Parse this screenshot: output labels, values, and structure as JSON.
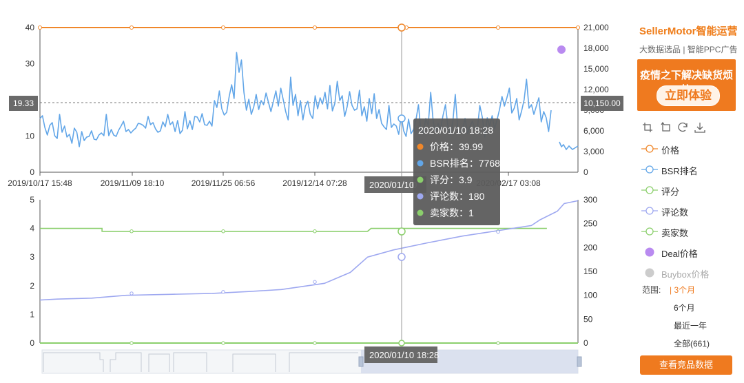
{
  "chart_data": [
    {
      "type": "line",
      "panel": "price-bsr",
      "x_ticks": [
        "2019/10/17 15:48",
        "2019/11/09 18:10",
        "2019/11/25 06:56",
        "2019/12/14 07:28",
        "2020/02/17 03:08"
      ],
      "y_left_ticks": [
        "0",
        "10",
        "20",
        "30",
        "40"
      ],
      "y_right_ticks": [
        "0",
        "3,000",
        "6,000",
        "9,000",
        "12,000",
        "15,000",
        "18,000",
        "21,000"
      ],
      "ylim_left": [
        0,
        40
      ],
      "ylim_right": [
        0,
        21000
      ],
      "reference_line": {
        "left_label": "19.33",
        "right_label": "10,150.00"
      },
      "series": [
        {
          "name": "价格",
          "color": "#f0872a",
          "axis": "left",
          "values": [
            40,
            40,
            40,
            40,
            40,
            40,
            40,
            40,
            40,
            40,
            40,
            40,
            40,
            40,
            40,
            40,
            40,
            40,
            40,
            40,
            40,
            40,
            40,
            40,
            40,
            40,
            40,
            40,
            40,
            40,
            40,
            40,
            40,
            40,
            40,
            40,
            40,
            40,
            40,
            40,
            40,
            40,
            40,
            40,
            40,
            40,
            40,
            40,
            40,
            40,
            40,
            40,
            40,
            40,
            40,
            40,
            40,
            40,
            40,
            40,
            40,
            40,
            40,
            40,
            40,
            40,
            40,
            40,
            40,
            40,
            40,
            40,
            40,
            40,
            40,
            40,
            40,
            40,
            40,
            40,
            40,
            40,
            40,
            40,
            40,
            40,
            40,
            40,
            40,
            40,
            40,
            40,
            40,
            40,
            40,
            40,
            40,
            40,
            40,
            40,
            40,
            40,
            40,
            40,
            40,
            40,
            40,
            40,
            40,
            40,
            40,
            40,
            40,
            40,
            40,
            40,
            40,
            40,
            40,
            40,
            40,
            40,
            40,
            40,
            40,
            40,
            40,
            40,
            40,
            40,
            40,
            40,
            40,
            40,
            40,
            40,
            40,
            40,
            40,
            40,
            40,
            40,
            40,
            40,
            40,
            40,
            40,
            40,
            40,
            40,
            40,
            40,
            40,
            40,
            40,
            40,
            40,
            40,
            40,
            40,
            40,
            40,
            40,
            40,
            40,
            40,
            40,
            40,
            40,
            40,
            40,
            40,
            40,
            40,
            40,
            40,
            40,
            40,
            40,
            40,
            40,
            40,
            40,
            40,
            40,
            40,
            40,
            40,
            40,
            40,
            40,
            40,
            40,
            40,
            40,
            40,
            40,
            40,
            40,
            40,
            40
          ]
        },
        {
          "name": "BSR排名",
          "color": "#62a6e8",
          "axis": "right",
          "values": [
            7800,
            8200,
            6500,
            5400,
            6800,
            7200,
            5300,
            4900,
            8400,
            5800,
            6700,
            5100,
            5500,
            4200,
            6400,
            5800,
            3700,
            5900,
            4600,
            5100,
            5200,
            6000,
            4800,
            4700,
            5400,
            5700,
            5300,
            8400,
            5300,
            6200,
            5400,
            5200,
            6100,
            6700,
            7400,
            5900,
            6200,
            5700,
            6100,
            6400,
            7100,
            7000,
            6800,
            6400,
            8100,
            6900,
            7200,
            6300,
            5800,
            6000,
            7300,
            6600,
            8400,
            6900,
            7300,
            5900,
            7500,
            5600,
            6100,
            8800,
            6300,
            7500,
            6200,
            8100,
            8000,
            7300,
            8500,
            6900,
            6800,
            7400,
            6700,
            10400,
            9400,
            11800,
            9200,
            8300,
            8700,
            11000,
            12700,
            10700,
            17400,
            14500,
            16300,
            11600,
            9000,
            10600,
            8400,
            9500,
            11300,
            9100,
            10400,
            9800,
            11500,
            10100,
            8800,
            10300,
            11800,
            9600,
            12200,
            10500,
            8800,
            7600,
            13800,
            9700,
            11300,
            8200,
            10400,
            7600,
            9600,
            10300,
            8400,
            7800,
            11100,
            9200,
            10800,
            9900,
            11600,
            9200,
            12600,
            8900,
            10000,
            13200,
            10400,
            11100,
            8100,
            9500,
            11700,
            9700,
            9000,
            9200,
            11900,
            8200,
            9500,
            7400,
            10700,
            8500,
            11400,
            7800,
            9100,
            7100,
            6600,
            6200,
            9700,
            6500,
            7000,
            6700,
            5500,
            8200,
            6000,
            5200,
            7700,
            5600,
            6200,
            7600,
            9800,
            6100,
            5700,
            7800,
            6800,
            11600,
            7400,
            5700,
            7100,
            6200,
            8200,
            9800,
            6600,
            5500,
            7300,
            11300,
            6400,
            5800,
            6300,
            7800,
            5600,
            6700,
            7400,
            6300,
            6300,
            9700,
            8000,
            5100,
            7900,
            6700,
            8200,
            6300,
            7600,
            9100,
            11000,
            9600,
            10800,
            12200,
            8600,
            9300,
            10700,
            7600,
            8900,
            10500,
            13500,
            9300,
            9800,
            8400,
            9600,
            10800,
            7300,
            8800,
            7900,
            5900,
            9000
          ]
        }
      ]
    },
    {
      "type": "line",
      "panel": "rating-reviews",
      "y_left_ticks": [
        "0",
        "1",
        "2",
        "3",
        "4",
        "5"
      ],
      "y_right_ticks": [
        "0",
        "50",
        "100",
        "150",
        "200",
        "250",
        "300"
      ],
      "ylim_left": [
        0,
        5
      ],
      "ylim_right": [
        0,
        300
      ],
      "series": [
        {
          "name": "评分",
          "color": "#8bcf6c",
          "axis": "left",
          "values": [
            [
              0,
              4.0
            ],
            [
              36,
              4.0
            ],
            [
              36,
              3.9
            ],
            [
              96,
              3.9
            ],
            [
              172,
              3.9
            ],
            [
              190,
              3.9
            ],
            [
              192,
              4.0
            ],
            [
              294,
              4.0
            ],
            [
              294,
              4.0
            ]
          ]
        },
        {
          "name": "评论数",
          "color": "#9ea8f0",
          "axis": "right",
          "values": [
            [
              0,
              90
            ],
            [
              10,
              92
            ],
            [
              30,
              94
            ],
            [
              50,
              100
            ],
            [
              75,
              102
            ],
            [
              100,
              104
            ],
            [
              122,
              108
            ],
            [
              140,
              112
            ],
            [
              165,
              125
            ],
            [
              180,
              148
            ],
            [
              190,
              180
            ],
            [
              205,
              195
            ],
            [
              225,
              210
            ],
            [
              245,
              224
            ],
            [
              265,
              235
            ],
            [
              285,
              246
            ],
            [
              290,
              258
            ],
            [
              300,
              276
            ],
            [
              304,
              292
            ],
            [
              312,
              298
            ]
          ]
        },
        {
          "name": "卖家数",
          "color": "#8bcf6c",
          "axis": "right",
          "values": [
            [
              0,
              0
            ],
            [
              312,
              0
            ]
          ]
        }
      ]
    }
  ],
  "tooltip": {
    "title": "2020/01/10 18:28",
    "rows": [
      {
        "color": "#f0872a",
        "label": "价格：39.99"
      },
      {
        "color": "#62a6e8",
        "label": "BSR排名：7768"
      },
      {
        "color": "#8bcf6c",
        "label": "评分：3.9"
      },
      {
        "color": "#9ea8f0",
        "label": "评论数：180"
      },
      {
        "color": "#8bcf6c",
        "label": "卖家数：1"
      }
    ]
  },
  "cursor_labels": {
    "top": "2020/01/10",
    "top_partial": "0",
    "bottom": "2020/01/10 18:28"
  },
  "sidebar": {
    "brand": "SellerMotor智能运营",
    "brand_sub": "大数据选品 | 智能PPC广告",
    "promo_title": "疫情之下解决缺货烦恼",
    "promo_button": "立即体验",
    "legend": [
      {
        "label": "价格",
        "color": "#f0872a",
        "kind": "line"
      },
      {
        "label": "BSR排名",
        "color": "#62a6e8",
        "kind": "line"
      },
      {
        "label": "评分",
        "color": "#8bcf6c",
        "kind": "line"
      },
      {
        "label": "评论数",
        "color": "#9ea8f0",
        "kind": "line"
      },
      {
        "label": "卖家数",
        "color": "#8bcf6c",
        "kind": "line"
      },
      {
        "label": "Deal价格",
        "color": "#b98af0",
        "kind": "dot"
      },
      {
        "label": "Buybox价格",
        "color": "#cccccc",
        "kind": "dot"
      }
    ],
    "range_label": "范围:",
    "range_options": [
      "3个月",
      "6个月",
      "最近一年",
      "全部(661)"
    ],
    "range_active": "3个月",
    "cta": "查看竞品数据"
  }
}
